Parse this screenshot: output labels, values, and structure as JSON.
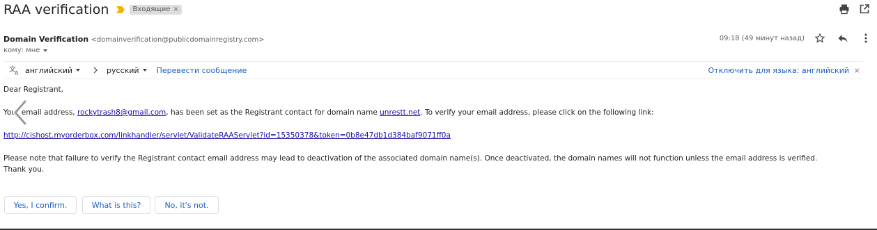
{
  "subject": "RAA verification",
  "label": {
    "text": "Входящие",
    "close": "×"
  },
  "sender": {
    "name": "Domain Verification",
    "email": "<domainverification@publicdomainregistry.com>",
    "to": "кому: мне"
  },
  "time": "09:18 (49 минут назад)",
  "translate": {
    "from_lang": "английский",
    "to_lang": "русский",
    "translate_link": "Перевести сообщение",
    "disable_link": "Отключить для языка: английский",
    "close": "×"
  },
  "body": {
    "greeting": "Dear Registrant,",
    "line1_a": "Your email address, ",
    "line1_email": "rockytrash8@gmail.com",
    "line1_b": ", has been set as the Registrant contact for domain name ",
    "line1_domain": "unrestt.net",
    "line1_c": ". To verify your email address, please click on the following link:",
    "link": "http://cishost.myorderbox.com/linkhandler/servlet/ValidateRAAServlet?id=15350378&token=0b8e47db1d384baf9071ff0a",
    "note": "Please note that failure to verify the Registrant contact email address may lead to deactivation of the associated domain name(s). Once deactivated, the domain names will not function unless the email address is verified.",
    "thanks": "Thank you."
  },
  "smart_replies": [
    "Yes, I confirm.",
    "What is this?",
    "No, it's not."
  ],
  "icons": {
    "importance": "label-important-icon",
    "print": "print-icon",
    "open_new": "open-in-new-window-icon",
    "star": "star-icon",
    "reply": "reply-icon",
    "more": "more-vert-icon",
    "translate": "translate-icon",
    "previous": "chevron-left-icon"
  },
  "colors": {
    "link": "#1a0dab",
    "accent": "#1a5ec6",
    "importance": "#f4b400"
  }
}
